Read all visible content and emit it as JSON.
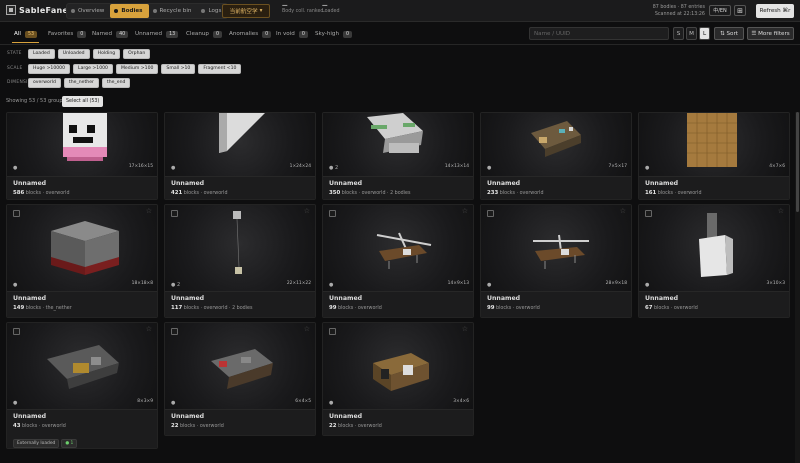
{
  "app": {
    "title": "SableFanel"
  },
  "nav": [
    {
      "label": "Overview",
      "active": false
    },
    {
      "label": "Bodies",
      "active": true
    },
    {
      "label": "Recycle bin",
      "active": false
    },
    {
      "label": "Logs",
      "active": false
    }
  ],
  "world_button": "当前航空学",
  "stats": [
    {
      "value": "—",
      "label": "Body coll. ranked"
    },
    {
      "value": "—",
      "label": "Loaded"
    }
  ],
  "top_right": {
    "line1": "87 bodies · 87 entries",
    "line2": "Scanned at 22:13:26"
  },
  "lang_button": "中/EN",
  "grid_icon": "grid-icon",
  "refresh_button": "Refresh ⌘r",
  "filter_tabs": [
    {
      "label": "All",
      "count": "53",
      "active": true
    },
    {
      "label": "Favorites",
      "count": "0"
    },
    {
      "label": "Named",
      "count": "40"
    },
    {
      "label": "Unnamed",
      "count": "13"
    },
    {
      "label": "Cleanup",
      "count": "0"
    },
    {
      "label": "Anomalies",
      "count": "0"
    },
    {
      "label": "In void",
      "count": "0"
    },
    {
      "label": "Sky-high",
      "count": "0"
    }
  ],
  "search": {
    "placeholder": "Name / UUID",
    "value": ""
  },
  "size_buttons": [
    {
      "label": "S"
    },
    {
      "label": "M"
    },
    {
      "label": "L",
      "active": true
    }
  ],
  "sort_button": "⇅ Sort",
  "more_filters_button": "☰ More filters",
  "filter_rows": [
    {
      "label": "STATE",
      "chips": [
        "Loaded",
        "Unloaded",
        "Holding",
        "Orphan"
      ]
    },
    {
      "label": "SCALE",
      "chips": [
        "Huge >10000",
        "Large >1000",
        "Medium >100",
        "Small >10",
        "Fragment <10"
      ]
    },
    {
      "label": "DIMENSION",
      "chips": [
        "overworld",
        "the_nether",
        "the_end"
      ]
    }
  ],
  "showing_text": "Showing 53 / 53 groups",
  "select_all_button": "Select all (53)",
  "cards": [
    {
      "name": "Unnamed",
      "blocks": "586",
      "meta": "blocks · overworld",
      "dims": "17×16×15",
      "marker": "●"
    },
    {
      "name": "Unnamed",
      "blocks": "421",
      "meta": "blocks · overworld",
      "dims": "1×24×24",
      "marker": "●"
    },
    {
      "name": "Unnamed",
      "blocks": "350",
      "meta": "blocks · overworld · 2 bodies",
      "dims": "14×13×14",
      "marker": "● 2"
    },
    {
      "name": "Unnamed",
      "blocks": "233",
      "meta": "blocks · overworld",
      "dims": "7×5×17",
      "marker": "●"
    },
    {
      "name": "Unnamed",
      "blocks": "161",
      "meta": "blocks · overworld",
      "dims": "4×7×6",
      "marker": "●"
    },
    {
      "name": "Unnamed",
      "blocks": "149",
      "meta": "blocks · the_nether",
      "dims": "18×18×8",
      "marker": "●"
    },
    {
      "name": "Unnamed",
      "blocks": "117",
      "meta": "blocks · overworld · 2 bodies",
      "dims": "22×11×22",
      "marker": "● 2"
    },
    {
      "name": "Unnamed",
      "blocks": "99",
      "meta": "blocks · overworld",
      "dims": "14×9×13",
      "marker": "●"
    },
    {
      "name": "Unnamed",
      "blocks": "99",
      "meta": "blocks · overworld",
      "dims": "28×9×18",
      "marker": "●"
    },
    {
      "name": "Unnamed",
      "blocks": "67",
      "meta": "blocks · overworld",
      "dims": "3×10×3",
      "marker": "●"
    },
    {
      "name": "Unnamed",
      "blocks": "43",
      "meta": "blocks · overworld",
      "dims": "8×3×9",
      "marker": "●",
      "tags": [
        "Externally loaded",
        "● 1"
      ]
    },
    {
      "name": "Unnamed",
      "blocks": "22",
      "meta": "blocks · overworld",
      "dims": "6×4×5",
      "marker": "●"
    },
    {
      "name": "Unnamed",
      "blocks": "22",
      "meta": "blocks · overworld",
      "dims": "3×4×6",
      "marker": "●"
    }
  ]
}
